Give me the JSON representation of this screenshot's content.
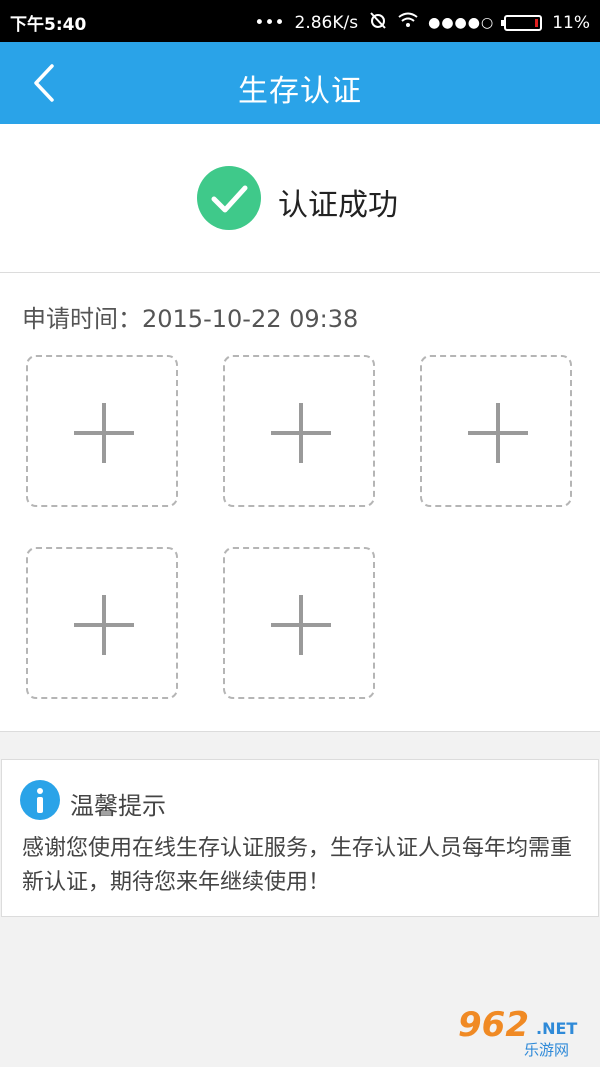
{
  "status_bar": {
    "time": "下午5:40",
    "speed": "2.86K/s",
    "signal": "●●●●○",
    "battery": "11%",
    "battery_level": 0.11,
    "battery_color": "#e02020"
  },
  "app_bar": {
    "title": "生存认证",
    "back_icon": "chevron-left-icon",
    "color": "#2aa3e8"
  },
  "result": {
    "label": "认证成功",
    "icon": "check-circle-icon",
    "color": "#3fc98a"
  },
  "application": {
    "time_label": "申请时间：",
    "time_value": "2015-10-22 09:38",
    "photo_slots": [
      "add-photo-icon",
      "add-photo-icon",
      "add-photo-icon",
      "add-photo-icon",
      "add-photo-icon"
    ]
  },
  "tips": {
    "icon": "info-icon",
    "title": "温馨提示",
    "body": "感谢您使用在线生存认证服务，生存认证人员每年均需重新认证，期待您来年继续使用！"
  },
  "watermark": {
    "number": "962",
    "suffix": ".NET",
    "text": "乐游网"
  }
}
